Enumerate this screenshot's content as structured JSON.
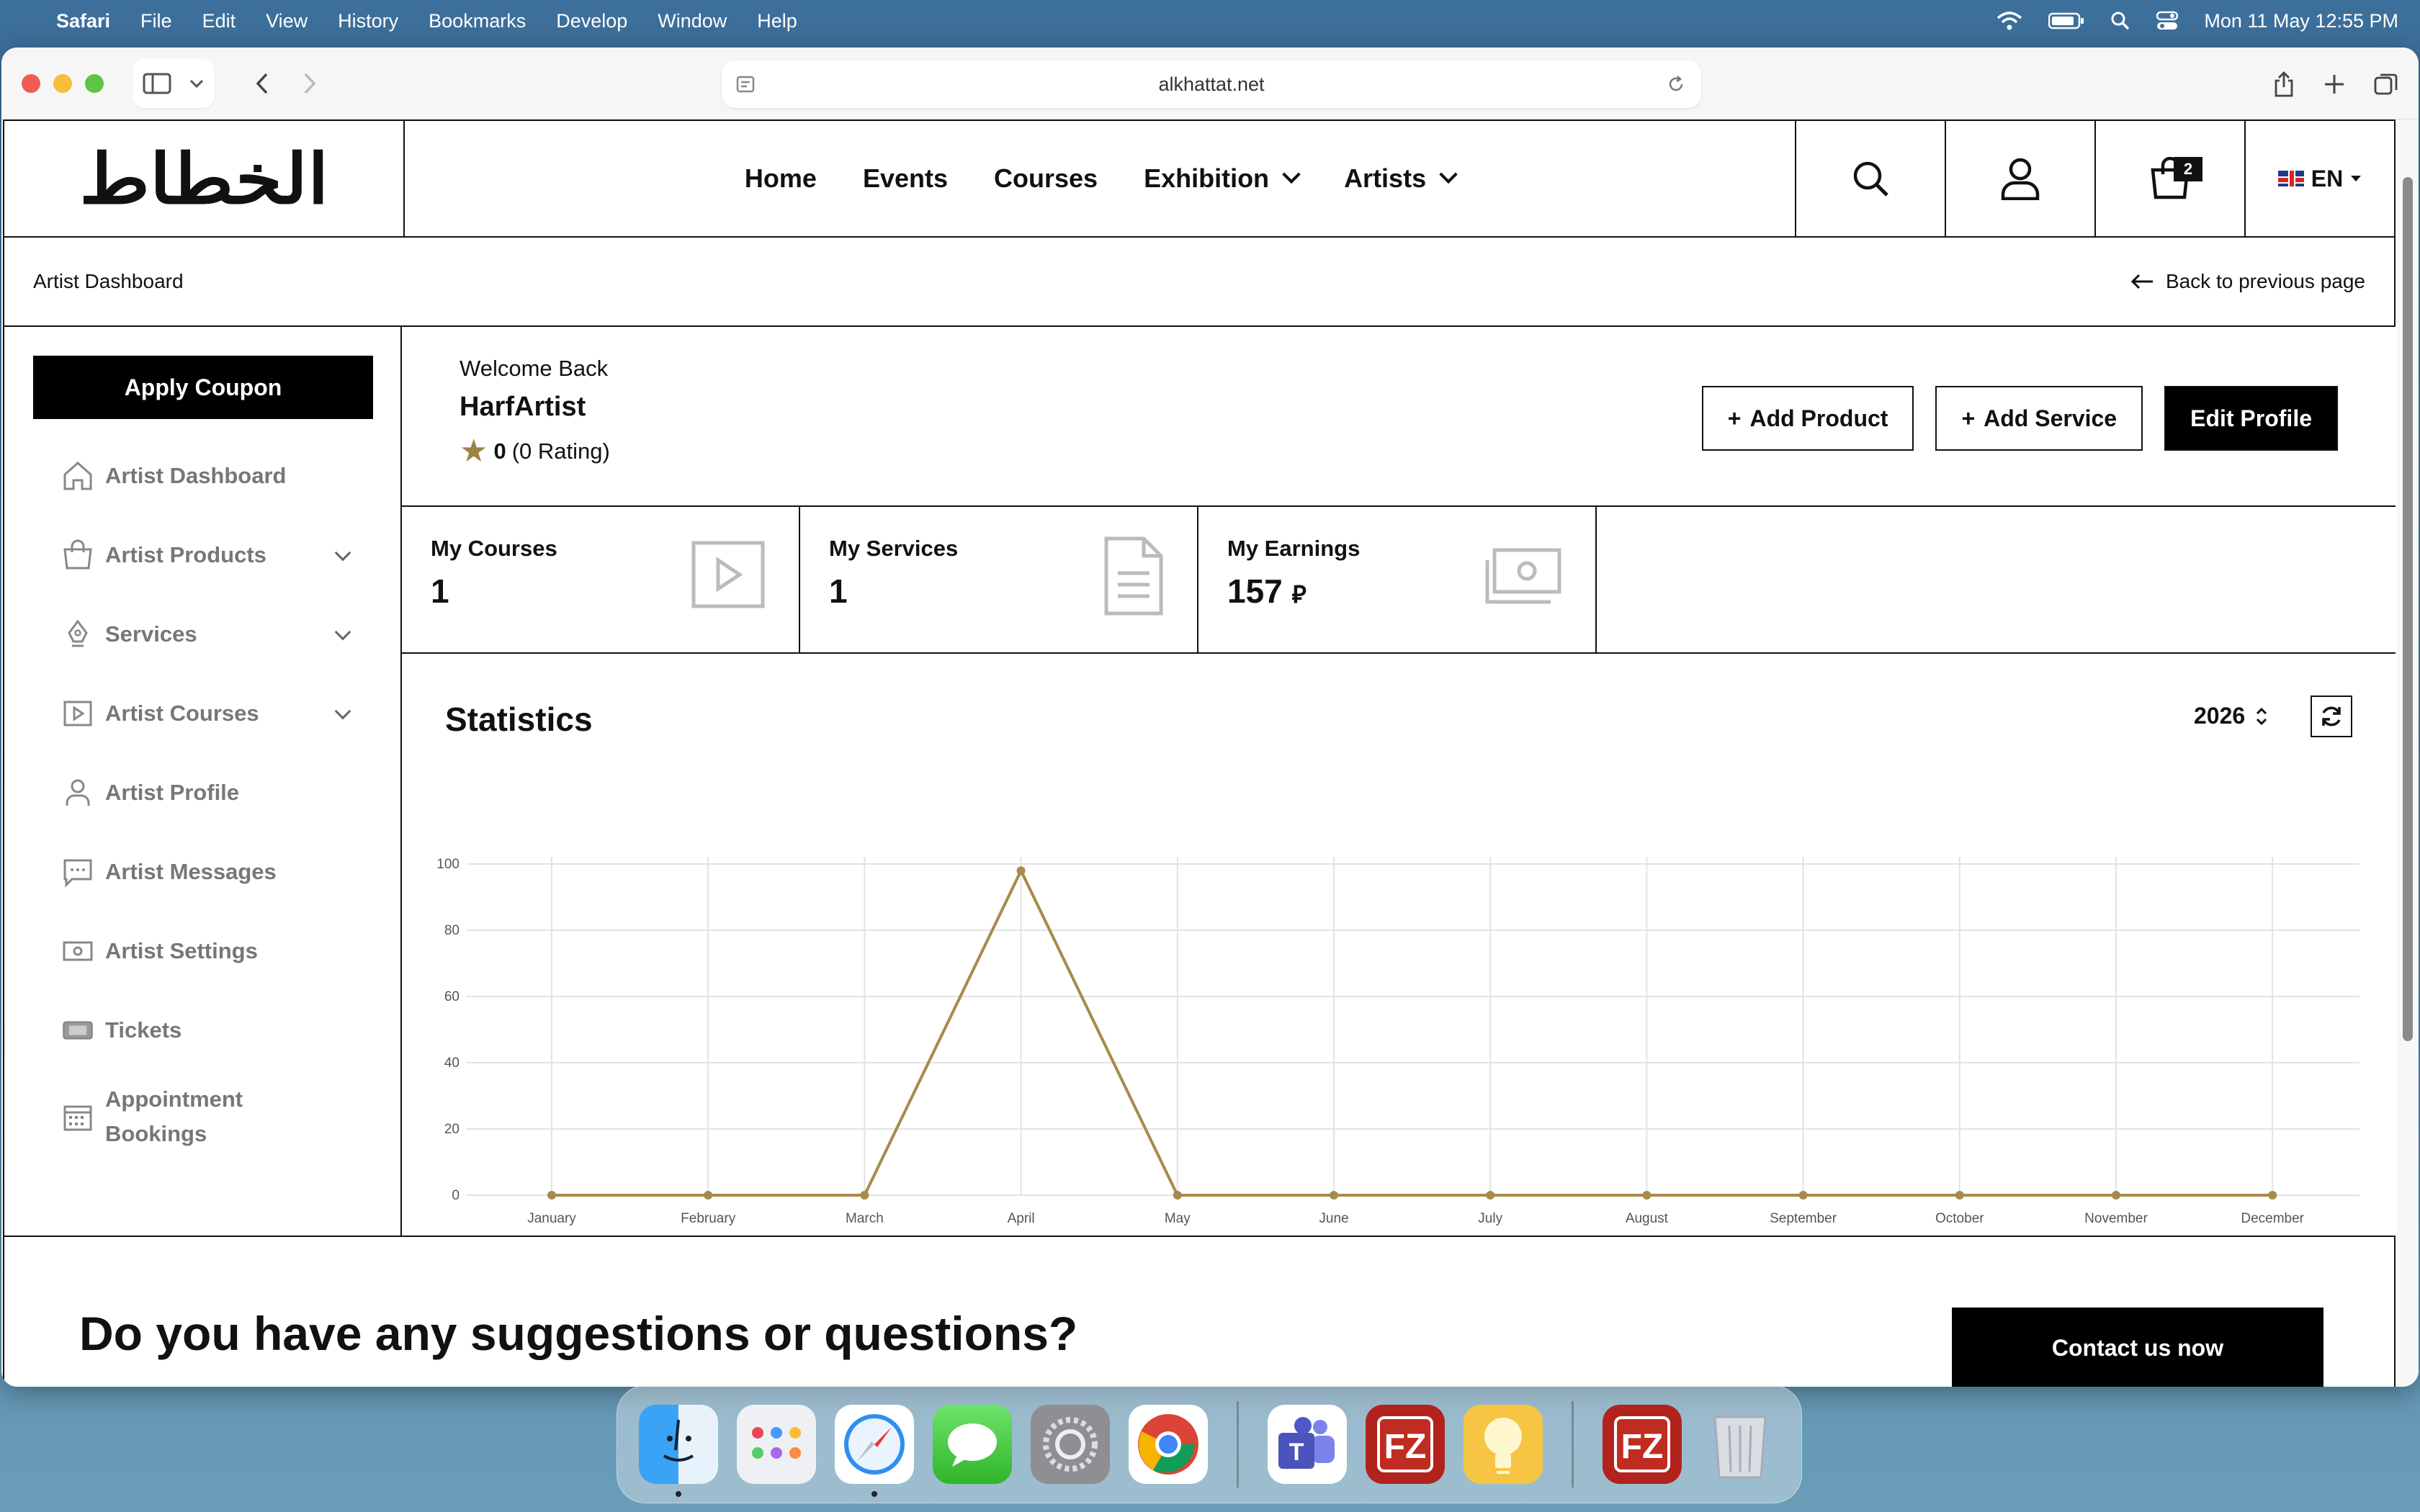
{
  "menubar": {
    "app_name": "Safari",
    "items": [
      "File",
      "Edit",
      "View",
      "History",
      "Bookmarks",
      "Develop",
      "Window",
      "Help"
    ],
    "clock": "Mon 11 May  12:55 PM"
  },
  "browser": {
    "url": "alkhattat.net"
  },
  "header": {
    "logo_text": "الخطاط",
    "nav": [
      {
        "label": "Home"
      },
      {
        "label": "Events"
      },
      {
        "label": "Courses"
      },
      {
        "label": "Exhibition"
      },
      {
        "label": "Artists"
      }
    ],
    "cart_count": "2",
    "language": "EN"
  },
  "subbar": {
    "title": "Artist Dashboard",
    "back_label": "Back to previous page"
  },
  "sidebar": {
    "coupon_label": "Apply Coupon",
    "items": [
      {
        "label": "Artist Dashboard",
        "icon": "home-icon"
      },
      {
        "label": "Artist Products",
        "icon": "bag-icon"
      },
      {
        "label": "Services",
        "icon": "pen-icon"
      },
      {
        "label": "Artist Courses",
        "icon": "play-icon"
      },
      {
        "label": "Artist Profile",
        "icon": "user-icon"
      },
      {
        "label": "Artist Messages",
        "icon": "message-icon"
      },
      {
        "label": "Artist Settings",
        "icon": "settings-icon"
      },
      {
        "label": "Tickets",
        "icon": "ticket-icon"
      },
      {
        "label": "Appointment Bookings",
        "icon": "calendar-icon"
      }
    ]
  },
  "welcome": {
    "greeting": "Welcome Back",
    "name": "HarfArtist",
    "rating_value": "0",
    "rating_text": "(0 Rating)",
    "add_product": "Add Product",
    "add_service": "Add Service",
    "edit_profile": "Edit Profile"
  },
  "stats": [
    {
      "label": "My Courses",
      "value": "1",
      "icon": "play-icon"
    },
    {
      "label": "My Services",
      "value": "1",
      "icon": "document-icon"
    },
    {
      "label": "My Earnings",
      "value": "157",
      "currency": "⃁",
      "icon": "money-icon"
    }
  ],
  "statistics": {
    "title": "Statistics",
    "year": "2026"
  },
  "chart_data": {
    "type": "line",
    "categories": [
      "January",
      "February",
      "March",
      "April",
      "May",
      "June",
      "July",
      "August",
      "September",
      "October",
      "November",
      "December"
    ],
    "values": [
      0,
      0,
      0,
      98,
      0,
      0,
      0,
      0,
      0,
      0,
      0,
      0
    ],
    "ylim": [
      0,
      100
    ],
    "yticks": [
      0,
      20,
      40,
      60,
      80,
      100
    ],
    "grid": true,
    "color": "#a68b4a"
  },
  "footer": {
    "question": "Do you have any suggestions or questions?",
    "contact_label": "Contact us now"
  },
  "dock": [
    "Finder",
    "Launchpad",
    "Safari",
    "Messages",
    "System Settings",
    "Chrome",
    "Teams",
    "FileZilla",
    "Tips",
    "FileZilla",
    "Trash"
  ]
}
